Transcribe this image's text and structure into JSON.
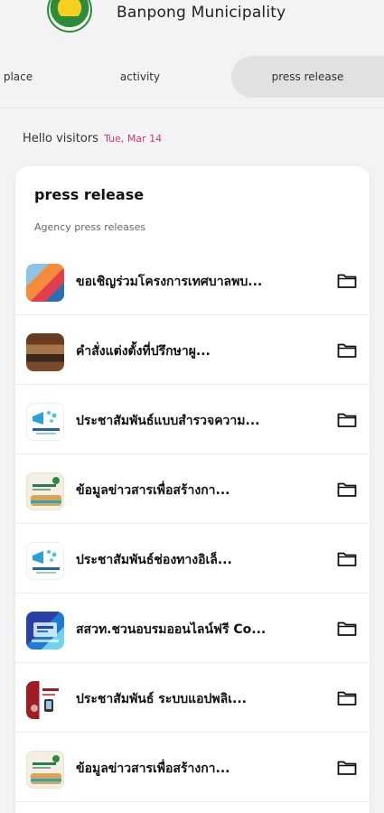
{
  "header": {
    "title": "Banpong Municipality"
  },
  "tabs": [
    {
      "label": "place"
    },
    {
      "label": "activity"
    },
    {
      "label": "press release",
      "selected": true
    }
  ],
  "greeting": {
    "text": "Hello visitors",
    "date": "Tue, Mar 14"
  },
  "card": {
    "title": "press release",
    "subtitle": "Agency press releases",
    "items": [
      {
        "title": "ขอเชิญร่วมโครงการเทศบาลพบ...",
        "icon": "thumb-colorful-poster"
      },
      {
        "title": "คำสั่งแต่งตั้งที่ปรึกษาผู...",
        "icon": "thumb-meeting-photo"
      },
      {
        "title": "ประชาสัมพันธ์แบบสำรวจความ...",
        "icon": "thumb-megaphone"
      },
      {
        "title": "ข้อมูลข่าวสารเพื่อสร้างกา...",
        "icon": "thumb-municipal-notice"
      },
      {
        "title": "ประชาสัมพันธ์ช่องทางอิเล็...",
        "icon": "thumb-megaphone"
      },
      {
        "title": "สสวท.ชวนอบรมออนไลน์ฟรี Co...",
        "icon": "thumb-online-course"
      },
      {
        "title": "ประชาสัมพันธ์ ระบบแอปพลิเ...",
        "icon": "thumb-app-poster"
      },
      {
        "title": "ข้อมูลข่าวสารเพื่อสร้างกา...",
        "icon": "thumb-municipal-notice"
      }
    ]
  },
  "colors": {
    "accent_date": "#d8336c",
    "selected_tab_bg": "#e1e1e4",
    "background": "#f3f3f5"
  }
}
